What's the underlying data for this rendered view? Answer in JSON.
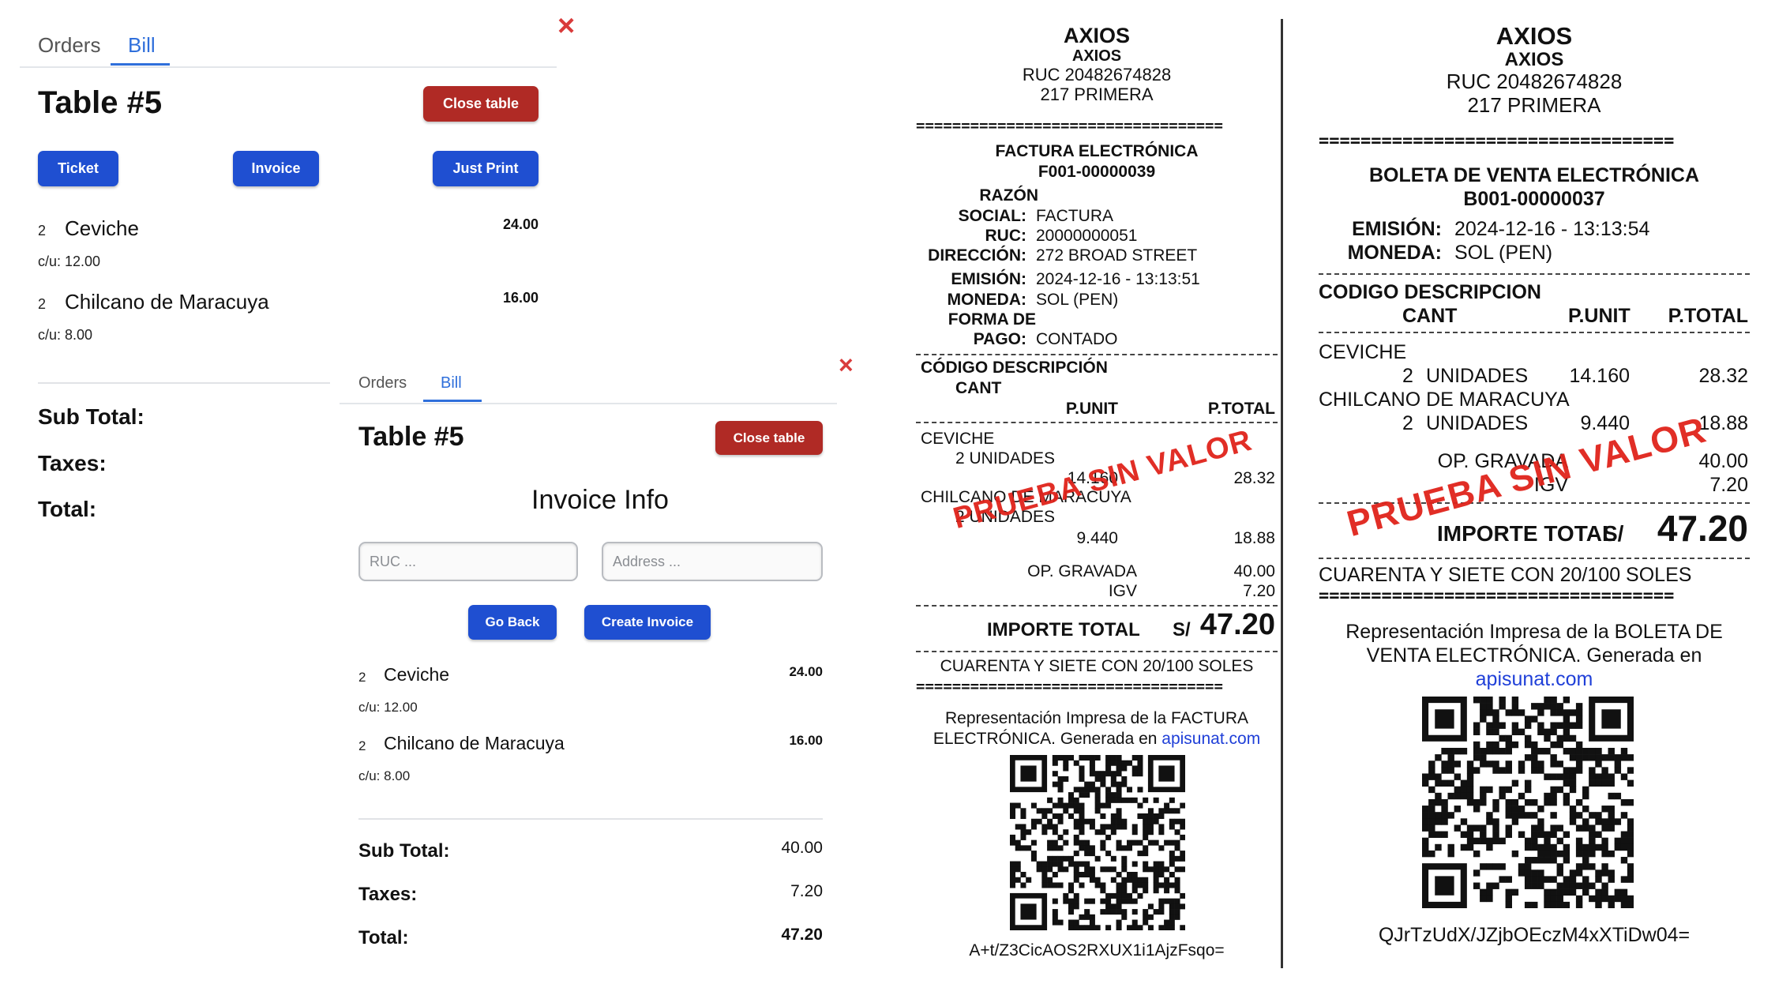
{
  "pos_back": {
    "tabs": {
      "orders": "Orders",
      "bill": "Bill"
    },
    "close_icon": "×",
    "title": "Table #5",
    "close_table": "Close table",
    "buttons": {
      "ticket": "Ticket",
      "invoice": "Invoice",
      "just_print": "Just Print"
    },
    "items": [
      {
        "qty": "2",
        "name": "Ceviche",
        "total": "24.00",
        "unit": "c/u: 12.00"
      },
      {
        "qty": "2",
        "name": "Chilcano de Maracuya",
        "total": "16.00",
        "unit": "c/u: 8.00"
      }
    ],
    "labels": {
      "subtotal": "Sub Total:",
      "taxes": "Taxes:",
      "total": "Total:"
    }
  },
  "pos_front": {
    "tabs": {
      "orders": "Orders",
      "bill": "Bill"
    },
    "close_icon": "×",
    "title": "Table #5",
    "close_table": "Close table",
    "invoice_info": "Invoice Info",
    "ruc_placeholder": "RUC ...",
    "address_placeholder": "Address ...",
    "buttons": {
      "go_back": "Go Back",
      "create_invoice": "Create Invoice"
    },
    "items": [
      {
        "qty": "2",
        "name": "Ceviche",
        "total": "24.00",
        "unit": "c/u: 12.00"
      },
      {
        "qty": "2",
        "name": "Chilcano de Maracuya",
        "total": "16.00",
        "unit": "c/u: 8.00"
      }
    ],
    "labels": {
      "subtotal": "Sub Total:",
      "taxes": "Taxes:",
      "total": "Total:"
    },
    "values": {
      "subtotal": "40.00",
      "taxes": "7.20",
      "total": "47.20"
    }
  },
  "factura": {
    "company": "AXIOS",
    "company_sub": "AXIOS",
    "ruc": "RUC 20482674828",
    "address": "217 PRIMERA",
    "separator": "==================================",
    "doc_type": "FACTURA ELECTRÓNICA",
    "doc_number": "F001-00000039",
    "client": {
      "razon_label_1": "RAZÓN",
      "razon_label_2": "SOCIAL:",
      "razon_value": "FACTURA",
      "ruc_label": "RUC:",
      "ruc_value": "20000000051",
      "direccion_label": "DIRECCIÓN:",
      "direccion_value": "272 BROAD STREET",
      "emision_label": "EMISIÓN:",
      "emision_value": "2024-12-16 - 13:13:51",
      "moneda_label": "MONEDA:",
      "moneda_value": "SOL (PEN)",
      "forma_label_1": "FORMA DE",
      "forma_label_2": "PAGO:",
      "forma_value": "CONTADO"
    },
    "headers": {
      "codigo": "CÓDIGO DESCRIPCIÓN",
      "cant": "CANT",
      "punit": "P.UNIT",
      "ptotal": "P.TOTAL"
    },
    "lines": [
      {
        "desc": "CEVICHE",
        "qty": "2 UNIDADES",
        "punit": "14.160",
        "ptotal": "28.32"
      },
      {
        "desc": "CHILCANO DE MARACUYA",
        "qty": "2 UNIDADES",
        "punit": "9.440",
        "ptotal": "18.88"
      }
    ],
    "op_gravada_label": "OP. GRAVADA",
    "op_gravada_value": "40.00",
    "igv_label": "IGV",
    "igv_value": "7.20",
    "importe_label": "IMPORTE TOTAL",
    "currency": "S/",
    "importe_value": "47.20",
    "amount_words": "CUARENTA Y SIETE CON 20/100 SOLES",
    "representation_1": "Representación Impresa de la FACTURA",
    "representation_2": "ELECTRÓNICA. Generada en ",
    "link": "apisunat.com",
    "hash": "A+t/Z3CicAOS2RXUX1i1AjzFsqo=",
    "watermark": "PRUEBA SIN VALOR"
  },
  "boleta": {
    "company": "AXIOS",
    "company_sub": "AXIOS",
    "ruc": "RUC 20482674828",
    "address": "217 PRIMERA",
    "separator": "==================================",
    "doc_type": "BOLETA DE VENTA ELECTRÓNICA",
    "doc_number": "B001-00000037",
    "emision_label": "EMISIÓN:",
    "emision_value": "2024-12-16 - 13:13:54",
    "moneda_label": "MONEDA:",
    "moneda_value": "SOL (PEN)",
    "headers": {
      "codigo": "CODIGO DESCRIPCION",
      "cant": "CANT",
      "punit": "P.UNIT",
      "ptotal": "P.TOTAL"
    },
    "lines": [
      {
        "desc": "CEVICHE",
        "qty": "2",
        "unit": "UNIDADES",
        "punit": "14.160",
        "ptotal": "28.32"
      },
      {
        "desc": "CHILCANO DE MARACUYA",
        "qty": "2",
        "unit": "UNIDADES",
        "punit": "9.440",
        "ptotal": "18.88"
      }
    ],
    "op_gravada_label": "OP. GRAVADA",
    "op_gravada_value": "40.00",
    "igv_label": "IGV",
    "igv_value": "7.20",
    "importe_label": "IMPORTE TOTAL",
    "currency": "S/",
    "importe_value": "47.20",
    "amount_words": "CUARENTA Y SIETE CON 20/100 SOLES",
    "representation_1": "Representación Impresa de la BOLETA DE",
    "representation_2": "VENTA ELECTRÓNICA. Generada en",
    "link": "apisunat.com",
    "hash": "QJrTzUdX/JZjbOEczM4xXTiDw04=",
    "watermark": "PRUEBA SIN VALOR"
  },
  "colors": {
    "accent_blue": "#1f4fd1",
    "tab_blue": "#2f6fdb",
    "danger_red": "#b02a25",
    "close_icon_red": "#d93b3b",
    "watermark_red": "#e0231b",
    "link_blue": "#1f3fd8"
  },
  "icons": {
    "close": "close-icon",
    "qr": "qr-code-icon"
  }
}
